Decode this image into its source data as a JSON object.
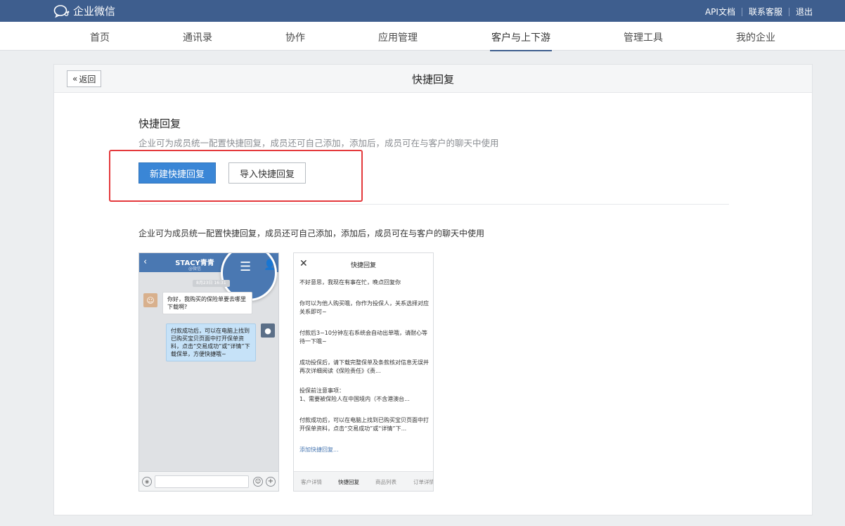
{
  "app": {
    "name": "企业微信"
  },
  "top_links": [
    "API文档",
    "联系客服",
    "退出"
  ],
  "nav": {
    "items": [
      "首页",
      "通讯录",
      "协作",
      "应用管理",
      "客户与上下游",
      "管理工具",
      "我的企业"
    ],
    "active": "客户与上下游"
  },
  "panel": {
    "back_label": "返回",
    "title": "快捷回复"
  },
  "section": {
    "title": "快捷回复",
    "description": "企业可为成员统一配置快捷回复，成员还可自己添加，添加后，成员可在与客户的聊天中使用",
    "new_button": "新建快捷回复",
    "import_button": "导入快捷回复",
    "intro": "企业可为成员统一配置快捷回复，成员还可自己添加，添加后，成员可在与客户的聊天中使用"
  },
  "colors": {
    "topbar": "#3e5e8e",
    "primary": "#3a86d6",
    "highlight": "#e4393c"
  },
  "phone_mock": {
    "chat_name": "STACY青青",
    "chat_sub": "@微信",
    "time": "8月23日 16:31",
    "msg_customer": "你好，我购买的保险单要去哪里下载啊?",
    "msg_agent": "付款成功后，可以在电脑上找到已购买宝贝页面中打开保单资料，点击“交易成功”或“详情”下载保单，方便快捷哦~"
  },
  "quick_reply_mock": {
    "title": "快捷回复",
    "items": [
      "不好意思，我现在有事在忙，晚点回复你",
      "你可以为他人购买哦，你作为投保人，关系选择对应关系即可~",
      "付款后3~10分钟左右系统会自动出单哦，请耐心等待一下哦~",
      "成功投保后，请下载完整保单及条款核对信息无误并再次详细阅读《保险责任》《责...",
      "投保前注意事项：\n1、需要被保险人在中国境内（不含港澳台...",
      "付款成功后，可以在电脑上找到已购买宝贝页面中打开保单资料，点击“交易成功”或“详情”下..."
    ],
    "add_link": "添加快捷回复...",
    "tabs": [
      "客户详情",
      "快捷回复",
      "商品列表",
      "订单详情"
    ],
    "active_tab": "快捷回复"
  }
}
